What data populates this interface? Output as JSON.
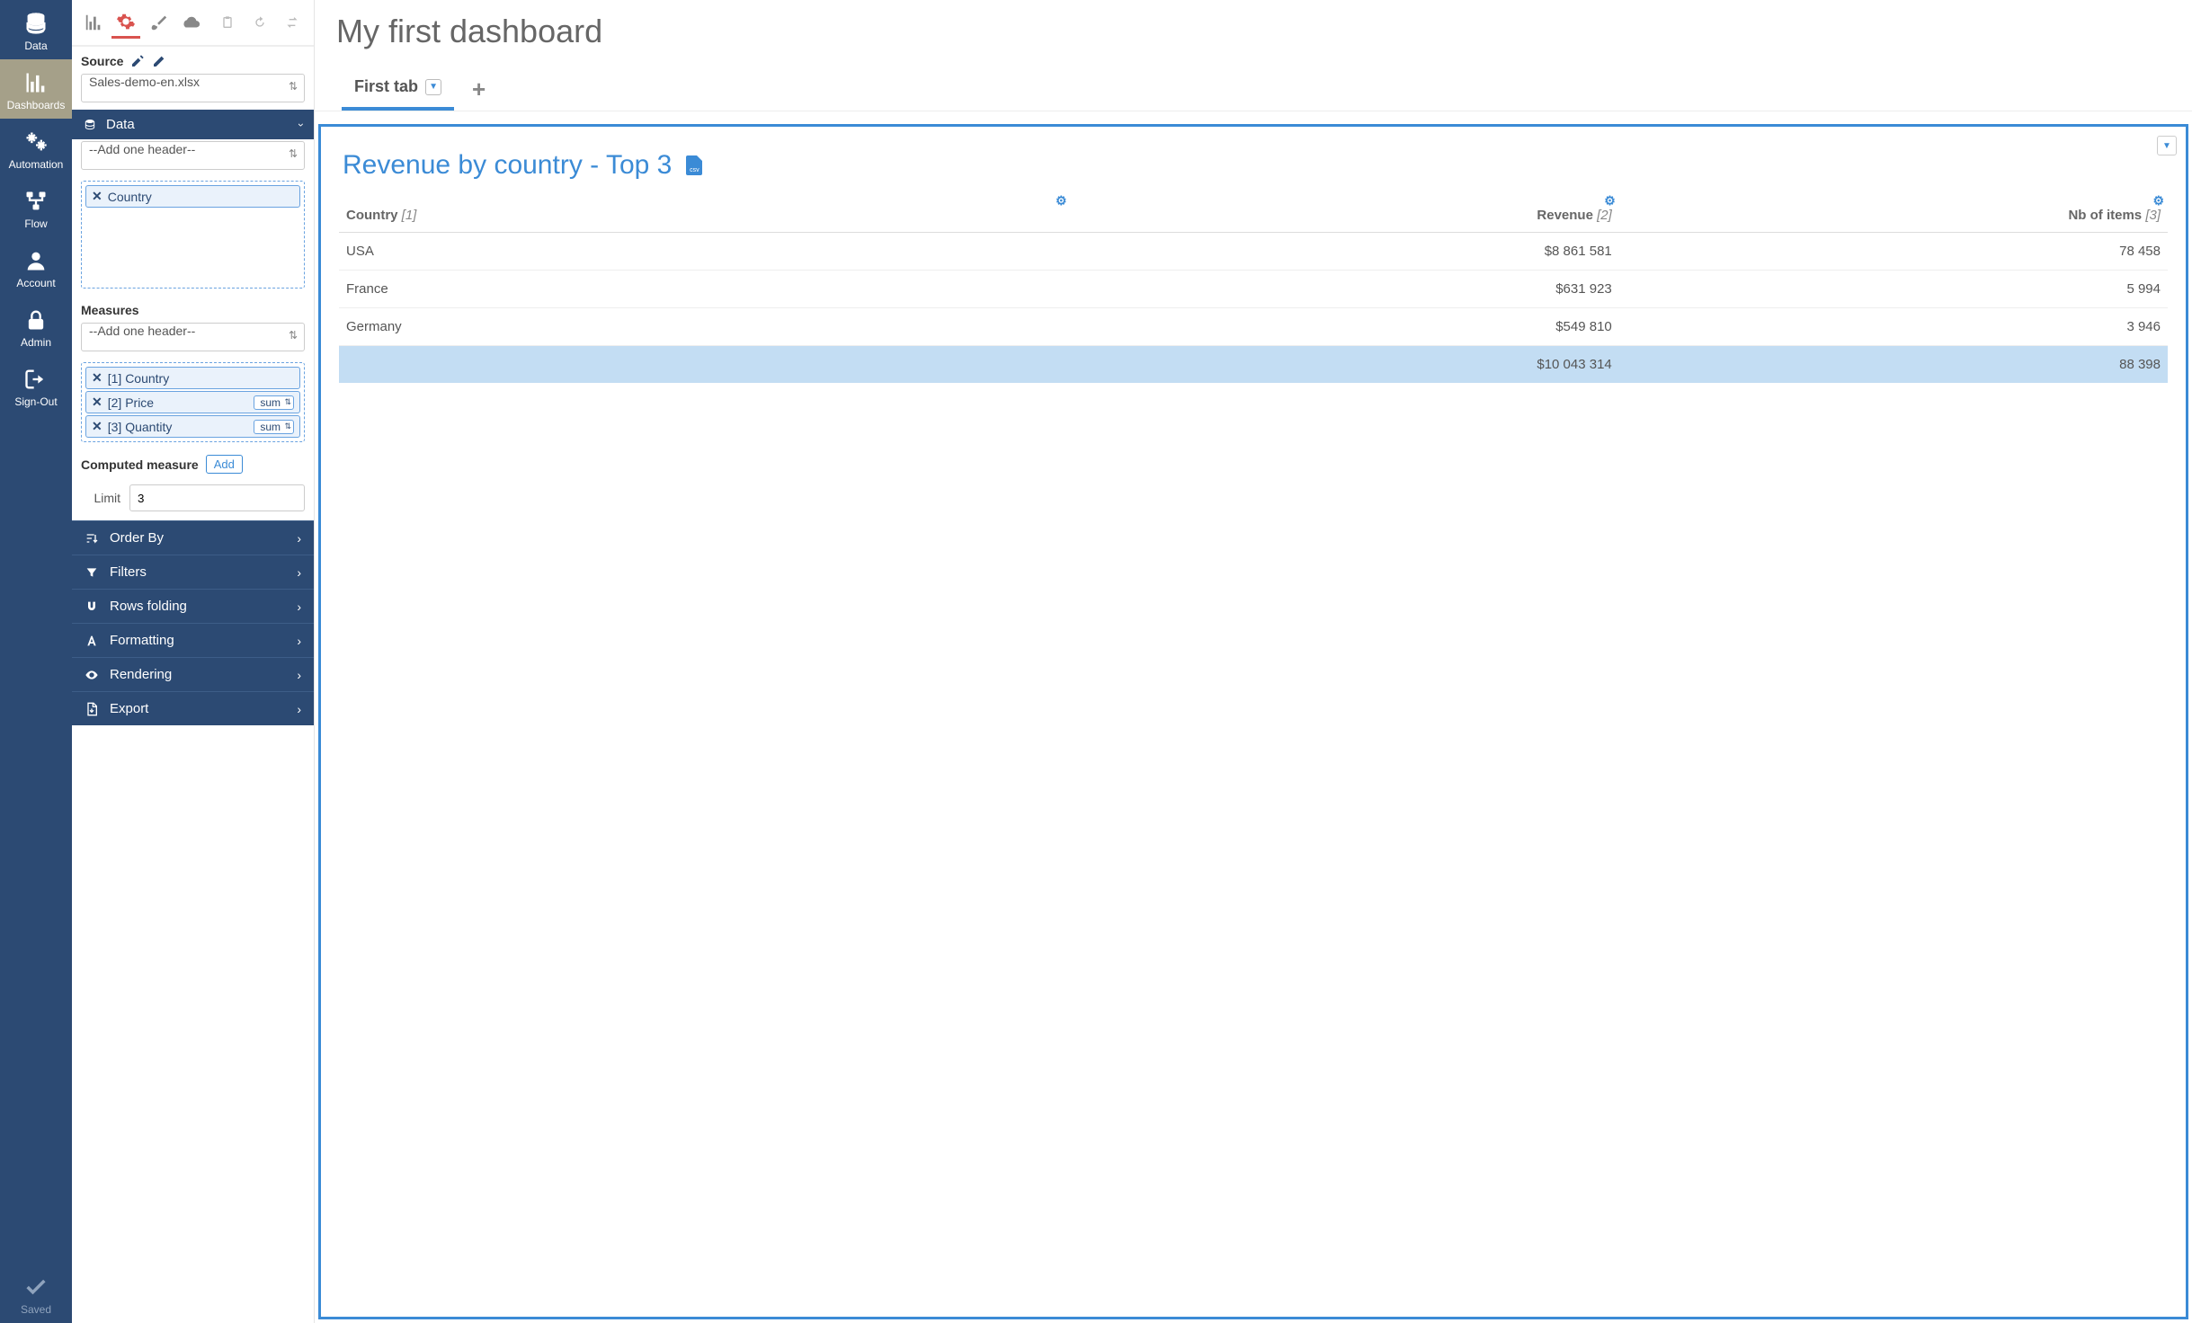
{
  "nav": {
    "items": [
      {
        "key": "data",
        "label": "Data"
      },
      {
        "key": "dashboards",
        "label": "Dashboards"
      },
      {
        "key": "automation",
        "label": "Automation"
      },
      {
        "key": "flow",
        "label": "Flow"
      },
      {
        "key": "account",
        "label": "Account"
      },
      {
        "key": "admin",
        "label": "Admin"
      },
      {
        "key": "signout",
        "label": "Sign-Out"
      }
    ],
    "saved_label": "Saved"
  },
  "config": {
    "source_label": "Source",
    "source_value": "Sales-demo-en.xlsx",
    "data_section": "Data",
    "add_header_placeholder": "--Add one header--",
    "data_pills": [
      {
        "label": "Country"
      }
    ],
    "measures_label": "Measures",
    "measure_pills": [
      {
        "label": "[1] Country",
        "agg": null
      },
      {
        "label": "[2] Price",
        "agg": "sum"
      },
      {
        "label": "[3] Quantity",
        "agg": "sum"
      }
    ],
    "computed_label": "Computed measure",
    "add_label": "Add",
    "limit_label": "Limit",
    "limit_value": "3",
    "accordion": [
      {
        "key": "orderby",
        "label": "Order By"
      },
      {
        "key": "filters",
        "label": "Filters"
      },
      {
        "key": "rowsfolding",
        "label": "Rows folding"
      },
      {
        "key": "formatting",
        "label": "Formatting"
      },
      {
        "key": "rendering",
        "label": "Rendering"
      },
      {
        "key": "export",
        "label": "Export"
      }
    ]
  },
  "main": {
    "title": "My first dashboard",
    "tab_label": "First tab",
    "widget_title": "Revenue by country - Top 3",
    "csv_label": "csv",
    "columns": [
      {
        "label": "Country",
        "idx": "[1]"
      },
      {
        "label": "Revenue",
        "idx": "[2]"
      },
      {
        "label": "Nb of items",
        "idx": "[3]"
      }
    ],
    "rows": [
      {
        "c0": "USA",
        "c1": "$8 861 581",
        "c2": "78 458"
      },
      {
        "c0": "France",
        "c1": "$631 923",
        "c2": "5 994"
      },
      {
        "c0": "Germany",
        "c1": "$549 810",
        "c2": "3 946"
      }
    ],
    "total": {
      "c0": "",
      "c1": "$10 043 314",
      "c2": "88 398"
    }
  },
  "chart_data": {
    "type": "table",
    "title": "Revenue by country - Top 3",
    "columns": [
      "Country",
      "Revenue",
      "Nb of items"
    ],
    "rows": [
      [
        "USA",
        8861581,
        78458
      ],
      [
        "France",
        631923,
        5994
      ],
      [
        "Germany",
        549810,
        3946
      ]
    ],
    "totals": [
      null,
      10043314,
      88398
    ],
    "currency": "USD"
  }
}
